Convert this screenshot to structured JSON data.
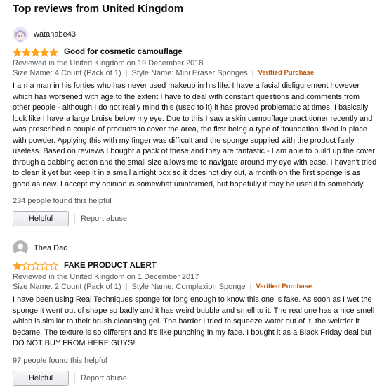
{
  "section": {
    "title": "Top reviews from United Kingdom"
  },
  "colors": {
    "star": "#ffa41c",
    "verified": "#c45500",
    "meta": "#565959"
  },
  "reviews": [
    {
      "avatar_icon": "anime-avatar-icon",
      "profile_name": "watanabe43",
      "rating": 5,
      "title": "Good for cosmetic camouflage",
      "date": "Reviewed in the United Kingdom on 19 December 2018",
      "size": "Size Name: 4 Count (Pack of 1)",
      "style": "Style Name: Mini Eraser Sponges",
      "verified": "Verified Purchase",
      "body": "I am a man in his forties who has never used makeup in his life. I have a facial disfigurement however which has worsened with age to the extent I have to deal with constant questions and comments from other people - although I do not really mind this (used to it) it has proved problematic at times. I basically look like I have a large bruise below my eye. Due to this I saw a skin camouflage practitioner recently and was prescribed a couple of products to cover the area, the first being a type of 'foundation' fixed in place with powder. Applying this with my finger was difficult and the sponge supplied with the product fairly useless. Based on reviews I bought a pack of these and they are fantastic - I am able to build up the cover through a dabbing action and the small size allows me to navigate around my eye with ease. I haven't tried to clean it yet but keep it in a small airtight box so it does not dry out, a month on the first sponge is as good as new. I accept my opinion is somewhat uninformed, but hopefully it may be useful to somebody.",
      "helpful_count": "234 people found this helpful",
      "helpful_label": "Helpful",
      "report_label": "Report abuse"
    },
    {
      "avatar_icon": "default-user-avatar-icon",
      "profile_name": "Thea Dao",
      "rating": 1,
      "title": "FAKE PRODUCT ALERT",
      "date": "Reviewed in the United Kingdom on 1 December 2017",
      "size": "Size Name: 2 Count (Pack of 1)",
      "style": "Style Name: Complexion Sponge",
      "verified": "Verified Purchase",
      "body": "I have been using Real Techniques sponge for long enough to know this one is fake. As soon as I wet the sponge it went out of shape so badly and it has weird bubble and smell to it. The real one has a nice smell which is similar to their brush cleansing gel. The harder I tried to squeeze water out of it, the weirder it became. The texture is so different and it's like punching in my face. I bought it as a Black Friday deal but DO NOT BUY FROM HERE GUYS!",
      "helpful_count": "97 people found this helpful",
      "helpful_label": "Helpful",
      "report_label": "Report abuse"
    }
  ]
}
